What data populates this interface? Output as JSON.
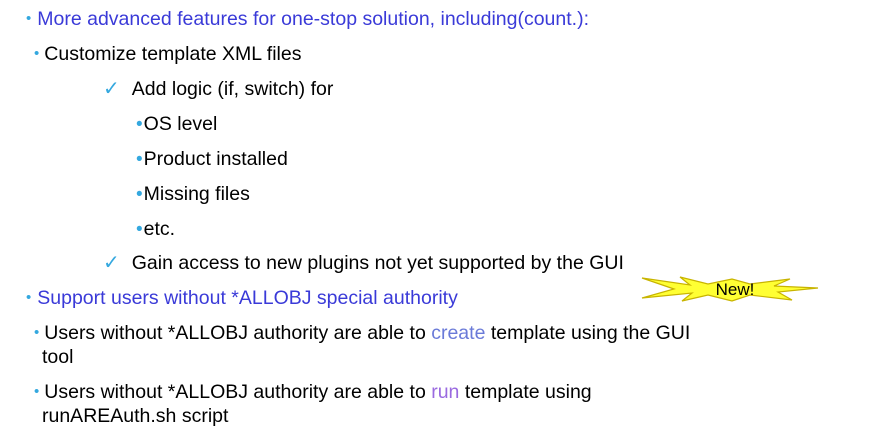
{
  "bullets": {
    "l1": "More advanced features for one-stop solution, including(count.):",
    "l2": "Customize template XML files",
    "l3": "Add logic (if, switch) for",
    "l4": "OS level",
    "l5": "Product installed",
    "l6": "Missing files",
    "l7": "etc.",
    "l8": "Gain access to new plugins not yet supported by the GUI",
    "l9": "Support users without *ALLOBJ special authority",
    "l10_a": "Users without *ALLOBJ authority are able to ",
    "l10_hl": "create",
    "l10_b": " template using the GUI",
    "l11": "tool",
    "l12_a": "Users without *ALLOBJ authority are able to ",
    "l12_hl": "run",
    "l12_b": " template using",
    "l13": "runAREAuth.sh script"
  },
  "badge": {
    "label": "New!",
    "fill": "#ffff33",
    "stroke": "#c8b400"
  },
  "colors": {
    "heading": "#3a3ad8",
    "bullet": "#34a8df",
    "text": "#000000"
  }
}
